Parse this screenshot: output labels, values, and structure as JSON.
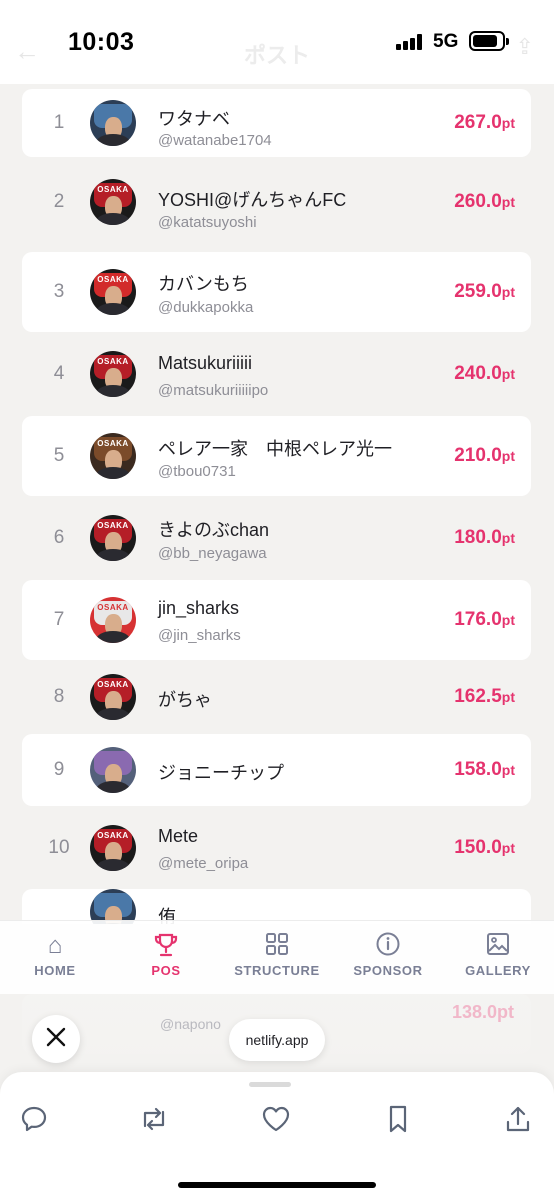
{
  "status_bar": {
    "time": "10:03",
    "network": "5G"
  },
  "page_header": {
    "title": "ポスト"
  },
  "ranking": [
    {
      "rank": "1",
      "name": "ワタナベ",
      "handle": "@watanabe1704",
      "points": "267.0",
      "unit": "pt"
    },
    {
      "rank": "2",
      "name": "YOSHI@げんちゃんFC",
      "handle": "@katatsuyoshi",
      "points": "260.0",
      "unit": "pt"
    },
    {
      "rank": "3",
      "name": "カバンもち",
      "handle": "@dukkapokka",
      "points": "259.0",
      "unit": "pt"
    },
    {
      "rank": "4",
      "name": "Matsukuriiiii",
      "handle": "@matsukuriiiiipo",
      "points": "240.0",
      "unit": "pt"
    },
    {
      "rank": "5",
      "name": "ペレア一家　中根ペレア光一",
      "handle": "@tbou0731",
      "points": "210.0",
      "unit": "pt"
    },
    {
      "rank": "6",
      "name": "きよのぶchan",
      "handle": "@bb_neyagawa",
      "points": "180.0",
      "unit": "pt"
    },
    {
      "rank": "7",
      "name": "jin_sharks",
      "handle": "@jin_sharks",
      "points": "176.0",
      "unit": "pt"
    },
    {
      "rank": "8",
      "name": "がちゃ",
      "handle": "",
      "points": "162.5",
      "unit": "pt"
    },
    {
      "rank": "9",
      "name": "ジョニーチップ",
      "handle": "",
      "points": "158.0",
      "unit": "pt"
    },
    {
      "rank": "10",
      "name": "Mete",
      "handle": "@mete_oripa",
      "points": "150.0",
      "unit": "pt"
    },
    {
      "rank": "",
      "name": "侑",
      "handle": "",
      "points": "",
      "unit": ""
    }
  ],
  "ghost_row": {
    "handle": "@napono",
    "points": "138.0pt"
  },
  "site_nav": [
    {
      "label": "HOME",
      "icon": "home-icon",
      "active": false
    },
    {
      "label": "POS",
      "icon": "trophy-icon",
      "active": true
    },
    {
      "label": "STRUCTURE",
      "icon": "grid-icon",
      "active": false
    },
    {
      "label": "SPONSOR",
      "icon": "info-icon",
      "active": false
    },
    {
      "label": "GALLERY",
      "icon": "image-icon",
      "active": false
    }
  ],
  "browser": {
    "url": "netlify.app"
  },
  "actions": [
    "reply-icon",
    "repost-icon",
    "like-icon",
    "bookmark-icon",
    "share-icon"
  ],
  "colors": {
    "accent": "#e5336e",
    "nav_inactive": "#7a7f95",
    "background": "#f3f2f0"
  }
}
